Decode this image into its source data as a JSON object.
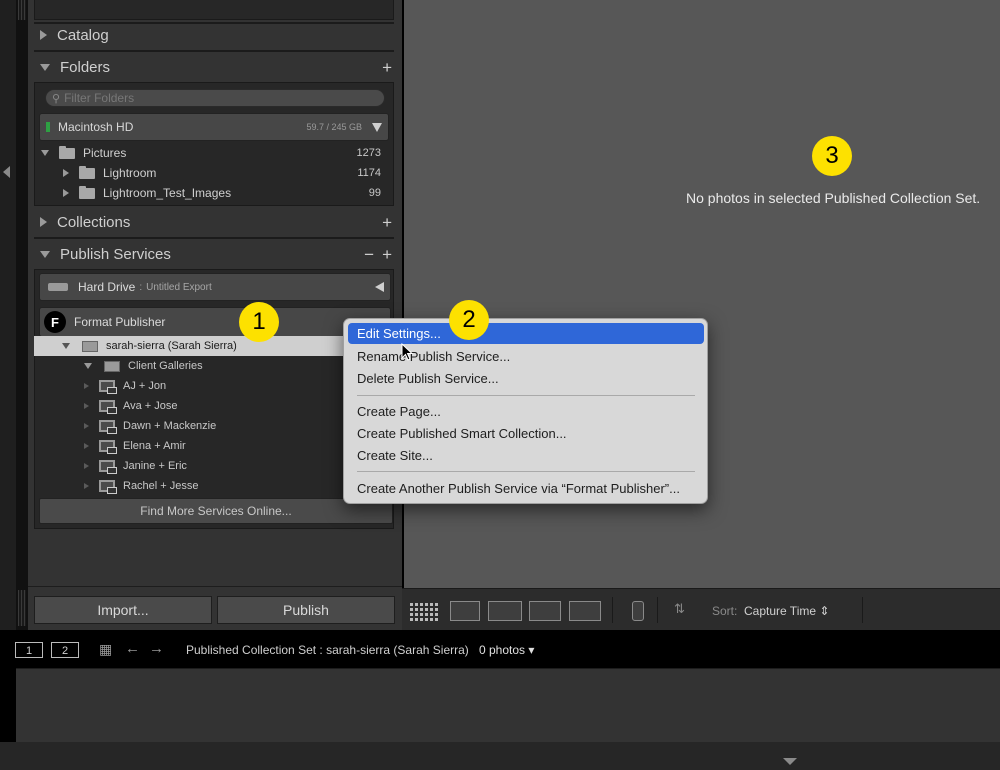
{
  "left_panel": {
    "catalog": {
      "title": "Catalog"
    },
    "folders": {
      "title": "Folders",
      "add_label": "+",
      "filter_placeholder": "Filter Folders",
      "volume": {
        "name": "Macintosh HD",
        "size": "59.7 / 245 GB"
      },
      "items": [
        {
          "name": "Pictures",
          "count": "1273"
        },
        {
          "name": "Lightroom",
          "count": "1174"
        },
        {
          "name": "Lightroom_Test_Images",
          "count": "99"
        }
      ]
    },
    "collections": {
      "title": "Collections",
      "add_label": "+"
    },
    "publish_services": {
      "title": "Publish Services",
      "remove_label": "−",
      "add_label": "+",
      "hard_drive": {
        "name": "Hard Drive",
        "separator": ":",
        "sub": "Untitled Export"
      },
      "format_publisher": {
        "logo": "F",
        "name": "Format Publisher"
      },
      "account": "sarah-sierra (Sarah Sierra)",
      "set": "Client Galleries",
      "collections": [
        "AJ + Jon",
        "Ava + Jose",
        "Dawn + Mackenzie",
        "Elena + Amir",
        "Janine + Eric",
        "Rachel + Jesse"
      ],
      "find_more": "Find More Services Online..."
    },
    "import_label": "Import...",
    "publish_label": "Publish"
  },
  "main": {
    "empty_message": "No photos in selected Published Collection Set."
  },
  "toolbar": {
    "sort_label": "Sort:",
    "sort_value": "Capture Time ⇕",
    "icons": [
      "grid-view-icon",
      "loupe-view-icon",
      "compare-view-icon",
      "survey-view-icon",
      "people-view-icon",
      "spray-can-icon",
      "sort-direction-icon"
    ]
  },
  "filmstrip": {
    "screen1": "1",
    "screen2": "2",
    "path": "Published Collection Set : sarah-sierra (Sarah Sierra)",
    "count": "0 photos ▾"
  },
  "context_menu": {
    "items": [
      {
        "label": "Edit Settings...",
        "highlighted": true
      },
      {
        "label": "Rename Publish Service..."
      },
      {
        "label": "Delete Publish Service..."
      },
      {
        "label": "Create Page..."
      },
      {
        "label": "Create Published Smart Collection..."
      },
      {
        "label": "Create Site..."
      },
      {
        "label": "Create Another Publish Service via “Format Publisher”..."
      }
    ]
  },
  "badges": [
    "1",
    "2",
    "3"
  ],
  "colors": {
    "highlight": "#2f67d8",
    "badge": "#fde100",
    "selected_row": "#cfcfcf"
  }
}
